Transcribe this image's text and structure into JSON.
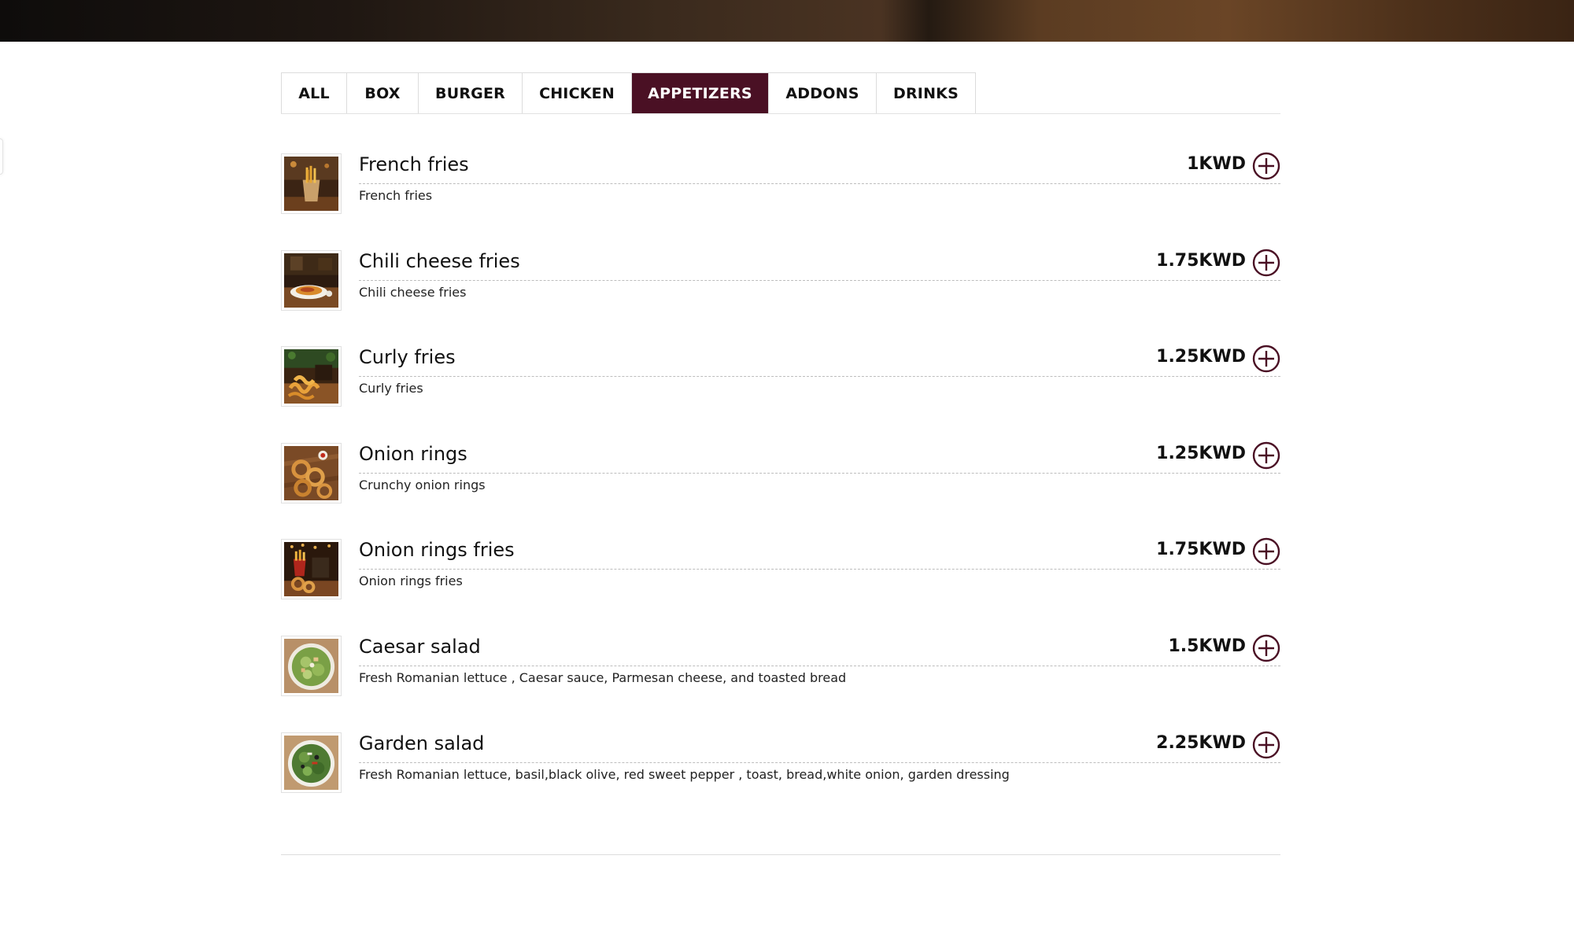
{
  "colors": {
    "accent": "#4a1024",
    "hero_dark": "#1f1712",
    "hero_warm": "#6a4526"
  },
  "tabs": [
    {
      "label": "ALL",
      "active": false
    },
    {
      "label": "BOX",
      "active": false
    },
    {
      "label": "BURGER",
      "active": false
    },
    {
      "label": "CHICKEN",
      "active": false
    },
    {
      "label": "APPETIZERS",
      "active": true
    },
    {
      "label": "ADDONS",
      "active": false
    },
    {
      "label": "DRINKS",
      "active": false
    }
  ],
  "items": [
    {
      "name": "French fries",
      "price": "1KWD",
      "desc": "French fries",
      "thumb": "fries-photo"
    },
    {
      "name": "Chili cheese fries",
      "price": "1.75KWD",
      "desc": "Chili cheese fries",
      "thumb": "chili-cheese-fries-photo"
    },
    {
      "name": "Curly fries",
      "price": "1.25KWD",
      "desc": "Curly fries",
      "thumb": "curly-fries-photo"
    },
    {
      "name": "Onion rings",
      "price": "1.25KWD",
      "desc": "Crunchy onion rings",
      "thumb": "onion-rings-photo"
    },
    {
      "name": "Onion rings fries",
      "price": "1.75KWD",
      "desc": "Onion rings fries",
      "thumb": "onion-rings-fries-photo"
    },
    {
      "name": "Caesar salad",
      "price": "1.5KWD",
      "desc": "Fresh Romanian lettuce , Caesar sauce, Parmesan cheese, and toasted bread",
      "thumb": "caesar-salad-photo"
    },
    {
      "name": "Garden salad",
      "price": "2.25KWD",
      "desc": "Fresh Romanian lettuce, basil,black olive, red sweet pepper , toast, bread,white onion, garden dressing",
      "thumb": "garden-salad-photo"
    }
  ]
}
